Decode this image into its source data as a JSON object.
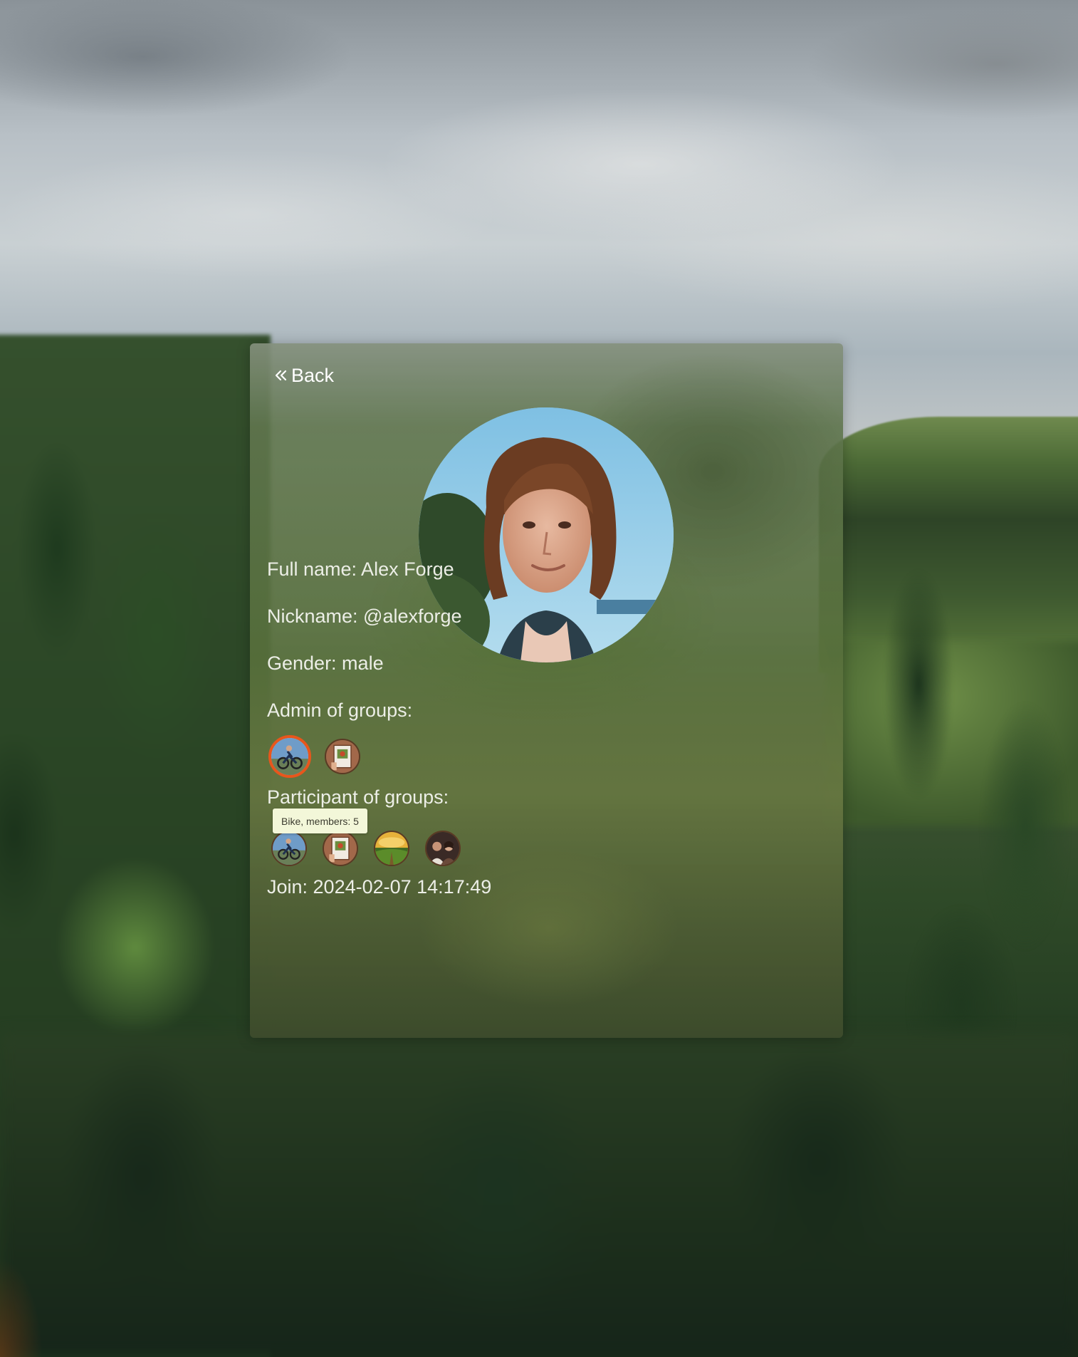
{
  "nav": {
    "back_label": "Back"
  },
  "profile": {
    "full_name": "Full name: Alex Forge",
    "nickname": "Nickname: @alexforge",
    "gender": "Gender: male",
    "admin_groups_label": "Admin of groups:",
    "participant_groups_label": "Participant of groups:",
    "join": "Join: 2024-02-07 14:17:49"
  },
  "tooltip": {
    "text": "Bike, members: 5"
  },
  "admin_groups": [
    {
      "icon": "cyclist-group-icon",
      "active": true
    },
    {
      "icon": "book-group-icon",
      "active": false
    }
  ],
  "participant_groups": [
    {
      "icon": "cyclist-group-icon"
    },
    {
      "icon": "book-group-icon"
    },
    {
      "icon": "nature-group-icon"
    },
    {
      "icon": "people-group-icon"
    }
  ],
  "colors": {
    "active_ring": "#e8561c",
    "tooltip_bg": "#f3f7d9",
    "text": "#eceee6"
  }
}
